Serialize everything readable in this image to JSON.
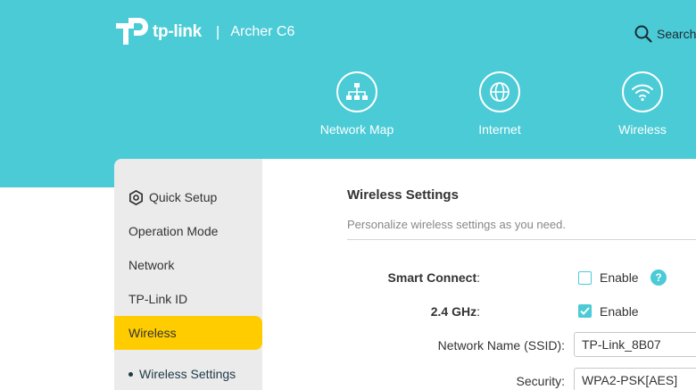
{
  "brand": {
    "logo_text": "tp-link",
    "separator": "|",
    "model": "Archer C6"
  },
  "search": {
    "label": "Search",
    "icon": "search-icon"
  },
  "nav": [
    {
      "label": "Network Map",
      "icon": "network-map-icon"
    },
    {
      "label": "Internet",
      "icon": "globe-icon"
    },
    {
      "label": "Wireless",
      "icon": "wifi-icon"
    }
  ],
  "sidebar": {
    "items": [
      {
        "label": "Quick Setup",
        "icon": "gear-icon"
      },
      {
        "label": "Operation Mode"
      },
      {
        "label": "Network"
      },
      {
        "label": "TP-Link ID"
      },
      {
        "label": "Wireless",
        "active": true
      }
    ],
    "subitems": [
      {
        "label": "Wireless Settings"
      }
    ]
  },
  "main": {
    "title": "Wireless Settings",
    "description": "Personalize wireless settings as you need.",
    "smart_connect": {
      "label": "Smart Connect",
      "colon": ":",
      "checked": false,
      "option": "Enable",
      "help": "?"
    },
    "band_24": {
      "label": "2.4 GHz",
      "colon": ":",
      "checked": true,
      "option": "Enable"
    },
    "ssid": {
      "label": "Network Name (SSID):",
      "value": "TP-Link_8B07"
    },
    "security": {
      "label": "Security:",
      "value": "WPA2-PSK[AES]"
    }
  },
  "colors": {
    "header": "#4acbd6",
    "accent": "#4acbd6",
    "active": "#ffcc00",
    "sidebar": "#ebebec"
  }
}
